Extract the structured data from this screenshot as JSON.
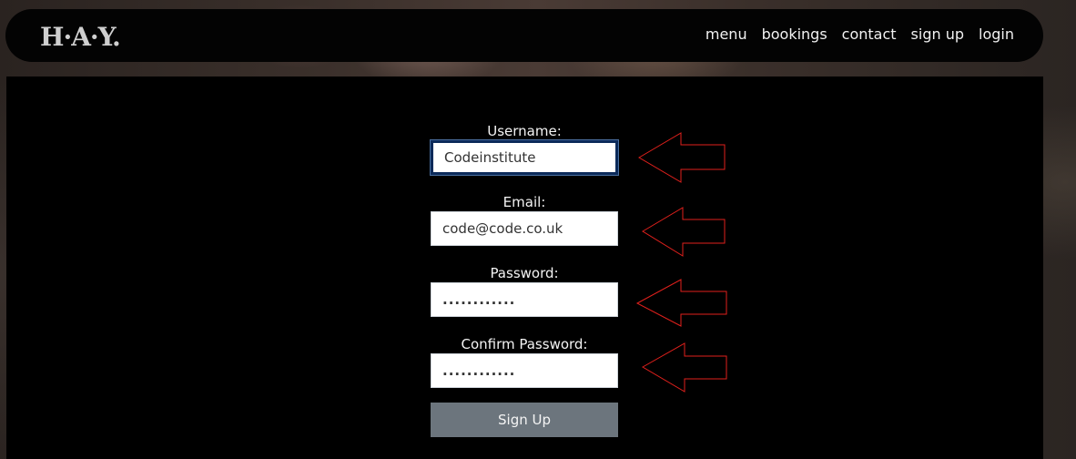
{
  "nav": {
    "brand": "H·A·Y.",
    "links": [
      "menu",
      "bookings",
      "contact",
      "sign up",
      "login"
    ]
  },
  "form": {
    "username": {
      "label": "Username:",
      "value": "Codeinstitute"
    },
    "email": {
      "label": "Email:",
      "value": "code@code.co.uk"
    },
    "password": {
      "label": "Password:",
      "value": "............"
    },
    "confirm_password": {
      "label": "Confirm Password:",
      "value": "............"
    },
    "submit_label": "Sign Up"
  },
  "colors": {
    "annotation_arrow": "#e0201c",
    "button": "#6c757d",
    "focus_border": "#0b2a5a"
  }
}
